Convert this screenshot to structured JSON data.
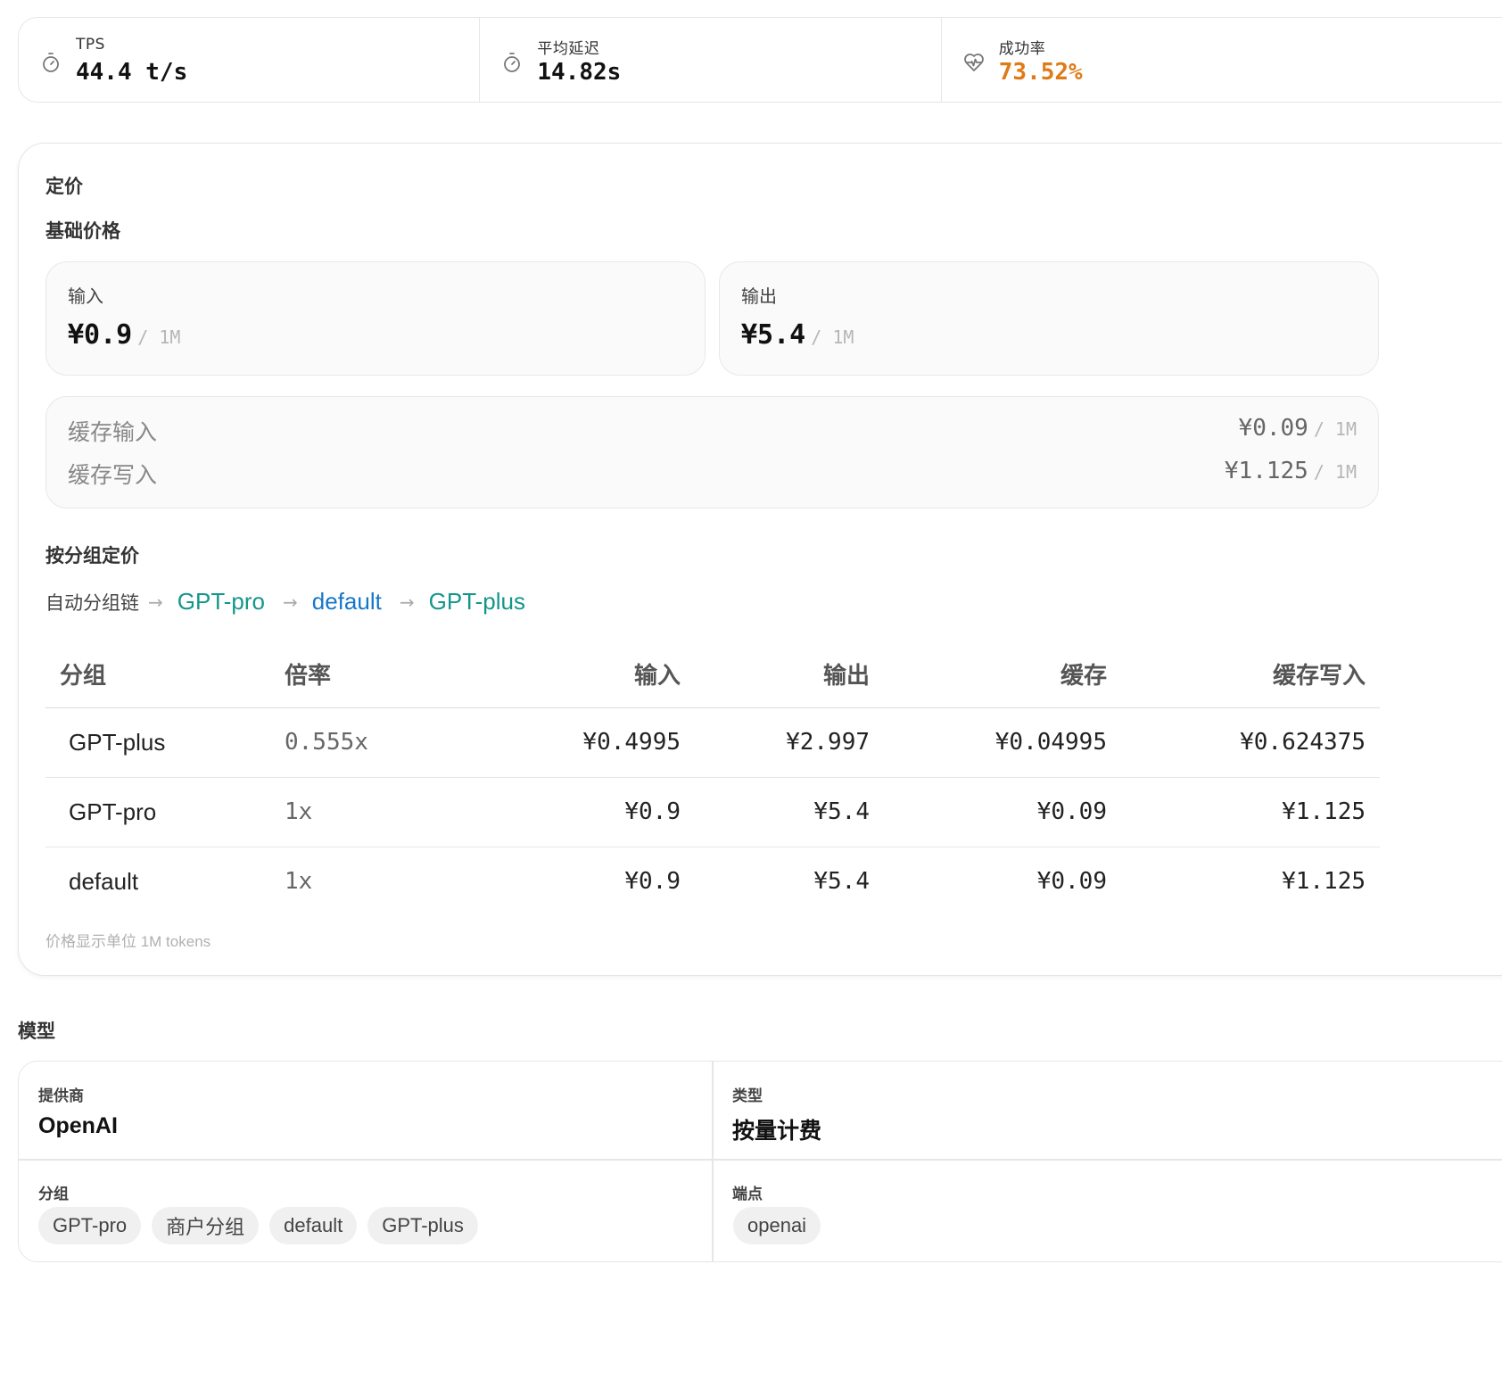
{
  "stats": [
    {
      "icon": "timer-icon",
      "label": "TPS",
      "value": "44.4 t/s",
      "color": "#111111"
    },
    {
      "icon": "timer-icon",
      "label": "平均延迟",
      "value": "14.82s",
      "color": "#111111"
    },
    {
      "icon": "heart-pulse-icon",
      "label": "成功率",
      "value": "73.52%",
      "color": "#e07a16"
    }
  ],
  "pricing": {
    "title": "定价",
    "base_title": "基础价格",
    "input": {
      "label": "输入",
      "price": "¥0.9",
      "unit": "/ 1M"
    },
    "output": {
      "label": "输出",
      "price": "¥5.4",
      "unit": "/ 1M"
    },
    "cache": [
      {
        "label": "缓存输入",
        "price": "¥0.09",
        "unit": "/ 1M"
      },
      {
        "label": "缓存写入",
        "price": "¥1.125",
        "unit": "/ 1M"
      }
    ],
    "group_title": "按分组定价",
    "chain_label": "自动分组链",
    "chain": [
      {
        "name": "GPT-pro",
        "color": "#14968a"
      },
      {
        "name": "default",
        "color": "#1677c8"
      },
      {
        "name": "GPT-plus",
        "color": "#14968a"
      }
    ],
    "table": {
      "headers": [
        "分组",
        "倍率",
        "输入",
        "输出",
        "缓存",
        "缓存写入"
      ],
      "rows": [
        {
          "group": "GPT-plus",
          "color": "#14968a",
          "rate": "0.555x",
          "input": "¥0.4995",
          "output": "¥2.997",
          "cache": "¥0.04995",
          "cache_write": "¥0.624375"
        },
        {
          "group": "GPT-pro",
          "color": "#14968a",
          "rate": "1x",
          "input": "¥0.9",
          "output": "¥5.4",
          "cache": "¥0.09",
          "cache_write": "¥1.125"
        },
        {
          "group": "default",
          "color": "#1677c8",
          "rate": "1x",
          "input": "¥0.9",
          "output": "¥5.4",
          "cache": "¥0.09",
          "cache_write": "¥1.125"
        }
      ]
    },
    "footnote": "价格显示单位 1M tokens"
  },
  "model": {
    "title": "模型",
    "provider_label": "提供商",
    "provider": "OpenAI",
    "type_label": "类型",
    "type": "按量计费",
    "groups_label": "分组",
    "groups": [
      "GPT-pro",
      "商户分组",
      "default",
      "GPT-plus"
    ],
    "endpoint_label": "端点",
    "endpoints": [
      "openai"
    ]
  }
}
